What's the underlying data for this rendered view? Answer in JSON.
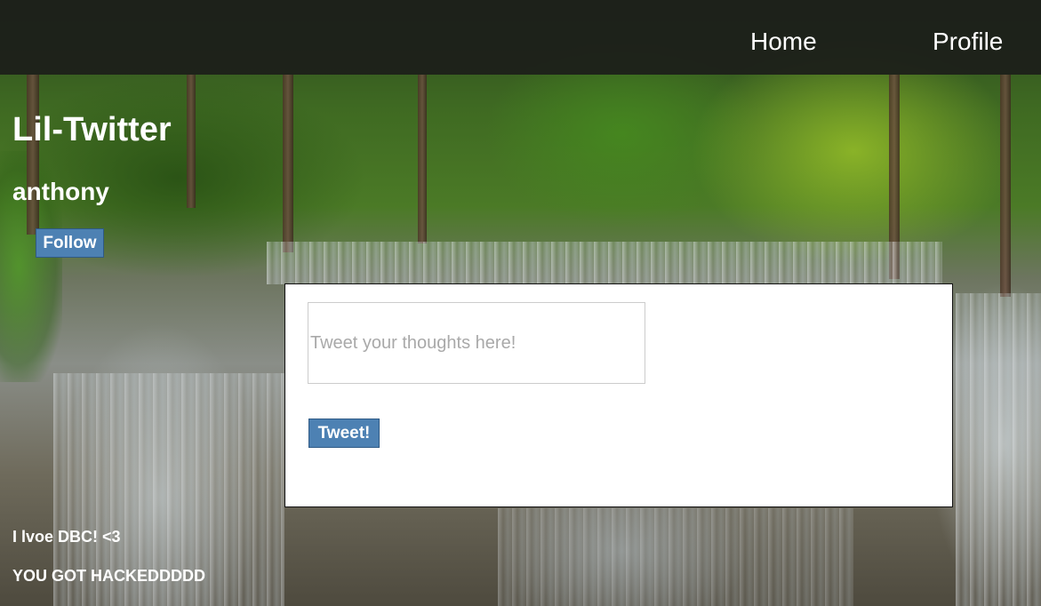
{
  "nav": {
    "home_label": "Home",
    "profile_label": "Profile"
  },
  "app": {
    "title": "Lil-Twitter"
  },
  "profile": {
    "username": "anthony",
    "follow_label": "Follow"
  },
  "composer": {
    "placeholder": "Tweet your thoughts here!",
    "value": "",
    "submit_label": "Tweet!"
  },
  "tweets": [
    {
      "text": "I lvoe DBC! <3"
    },
    {
      "text": "YOU GOT HACKEDDDDD"
    }
  ],
  "colors": {
    "button_bg": "#4d81b3",
    "navbar_bg": "#1c1e1a",
    "panel_bg": "#ffffff"
  }
}
